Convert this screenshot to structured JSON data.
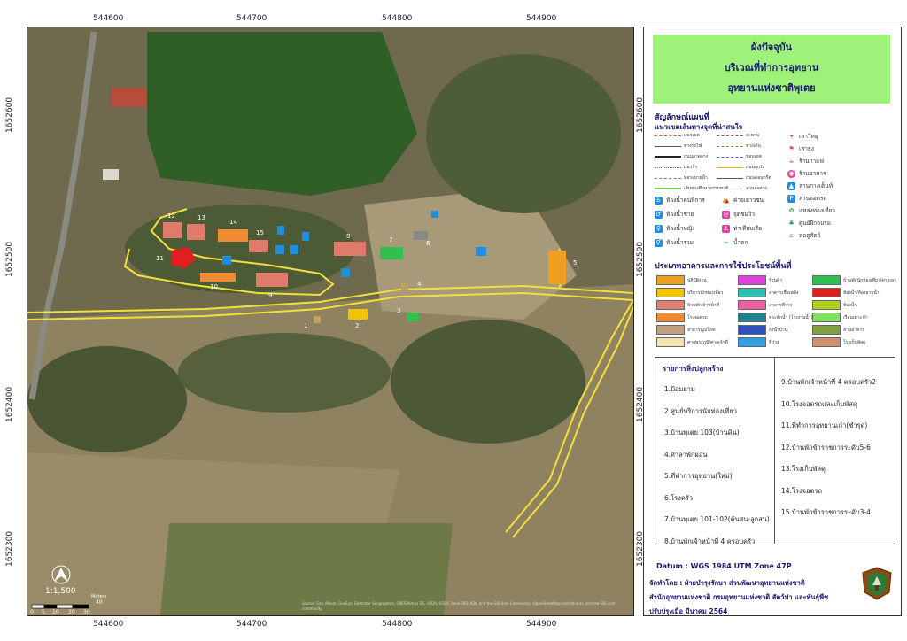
{
  "coordinates": {
    "x_top": [
      "544600",
      "544700",
      "544800",
      "544900"
    ],
    "x_bottom": [
      "544600",
      "544700",
      "544800",
      "544900"
    ],
    "y_left": [
      "1652600",
      "1652500",
      "1652400",
      "1652300"
    ],
    "y_right": [
      "1652600",
      "1652500",
      "1652400",
      "1652300"
    ]
  },
  "title": {
    "line1": "ผังปัจจุบัน",
    "line2": "บริเวณที่ทำการอุทยาน",
    "line3": "อุทยานแห่งชาติพุเตย"
  },
  "legend": {
    "heading": "สัญลักษณ์แผนที่",
    "sub": "แนวเขตเส้นทางจุดที่น่าสนใจ",
    "lines": [
      {
        "label": "แนวเขต",
        "color": "#e04a4a"
      },
      {
        "label": "ทางรถไฟ",
        "color": "#555555"
      },
      {
        "label": "ถนนลาดยาง",
        "color": "#222222"
      },
      {
        "label": "แนวรั้ว",
        "color": "#777777"
      },
      {
        "label": "สะพาน",
        "color": "#a05050"
      },
      {
        "label": "ทางเดิน",
        "color": "#b08040"
      },
      {
        "label": "ขอบเขต",
        "color": "#4060c0"
      },
      {
        "label": "ถนนลูกรัง",
        "color": "#e0c000"
      },
      {
        "label": "ท่อระบายน้ำ",
        "color": "#b060b0"
      },
      {
        "label": "ถนนคอนกรีต",
        "color": "#555555"
      },
      {
        "label": "เส้นทางศึกษาธรรมชาติ",
        "color": "#7ad04a"
      },
      {
        "label": "ลานจอดรถ",
        "color": "#999999"
      }
    ],
    "symbols": [
      {
        "label": "เสาวิทยุ",
        "color": "#ffffff",
        "glyph": "✦"
      },
      {
        "label": "เสาธง",
        "color": "#ffffff",
        "glyph": "⚑"
      },
      {
        "label": "ร้านกาแฟ",
        "color": "#ffffff",
        "glyph": "☕"
      },
      {
        "label": "ร้านอาหาร",
        "color": "#e040a0",
        "glyph": "◉"
      },
      {
        "label": "ลานกางเต็นท์",
        "color": "#1e8fe0",
        "glyph": "▲"
      },
      {
        "label": "ลานจอดรถ",
        "color": "#1e8fe0",
        "glyph": "P"
      },
      {
        "label": "แหล่งท่องเที่ยว",
        "color": "#ffffff",
        "glyph": "✿"
      },
      {
        "label": "ศูนย์ฝึกอบรม",
        "color": "#ffffff",
        "glyph": "♣"
      },
      {
        "label": "หอดูสัตว์",
        "color": "#ffffff",
        "glyph": "⌂"
      },
      {
        "label": "ห้องน้ำคนพิการ",
        "color": "#1e8fe0",
        "glyph": "♿"
      },
      {
        "label": "ค่ายเยาวชน",
        "color": "#ffffff",
        "glyph": "⛺"
      },
      {
        "label": "ห้องน้ำชาย",
        "color": "#1e8fe0",
        "glyph": "♂"
      },
      {
        "label": "จุดชมวิว",
        "color": "#e040a0",
        "glyph": "◎"
      },
      {
        "label": "ห้องน้ำหญิง",
        "color": "#1e8fe0",
        "glyph": "♀"
      },
      {
        "label": "ท่าเทียบเรือ",
        "color": "#e040a0",
        "glyph": "⚓"
      },
      {
        "label": "ห้องน้ำรวม",
        "color": "#1e8fe0",
        "glyph": "⚥"
      },
      {
        "label": "น้ำตก",
        "color": "#ffffff",
        "glyph": "≈"
      }
    ],
    "landuse_heading": "ประเภทอาคารและการใช้ประโยชน์พื้นที่",
    "landuse": [
      {
        "label": "ปฏิบัติงาน",
        "color": "#f0a020"
      },
      {
        "label": "บริการนักท่องเที่ยว",
        "color": "#f5c400"
      },
      {
        "label": "บ้านพักเจ้าหน้าที่",
        "color": "#e08070"
      },
      {
        "label": "โรงจอดรถ",
        "color": "#f08a30"
      },
      {
        "label": "สาธารณูปโภค",
        "color": "#c0a080"
      },
      {
        "label": "ศาลพระภูมิ/ศาลเจ้าที่",
        "color": "#f5e0b0"
      },
      {
        "label": "ร้านค้า",
        "color": "#e040e0"
      },
      {
        "label": "อาคารเชื้อเพลิง",
        "color": "#30c0b0"
      },
      {
        "label": "อาคารที่ว่าง",
        "color": "#f060a0"
      },
      {
        "label": "พระพักน้ำ (โรงงานน้ำ)",
        "color": "#208090"
      },
      {
        "label": "ถังน้ำบ้าน",
        "color": "#3050c0"
      },
      {
        "label": "ที่ว่าง",
        "color": "#30a0e0"
      },
      {
        "label": "บ้านพักนักท่องเที่ยว/ค่ายเยาวชน",
        "color": "#30c050"
      },
      {
        "label": "ห้องน้ำ/ห้องอาบน้ำ",
        "color": "#e02020"
      },
      {
        "label": "ห้องน้ำ",
        "color": "#b0d020"
      },
      {
        "label": "เรือนเพาะชำ",
        "color": "#80e060"
      },
      {
        "label": "ลานอาคาร",
        "color": "#80a040"
      },
      {
        "label": "โรงเก็บพัสดุ",
        "color": "#d0906a"
      }
    ]
  },
  "buildings_list": {
    "heading": "รายการสิ่งปลูกสร้าง",
    "left": [
      "1.ป้อมยาม",
      "2.ศูนย์บริการนักท่องเที่ยว",
      "3.บ้านพุเตย 103(บ้านดิน)",
      "4.ศาลาพักผ่อน",
      "5.ที่ทำการอุทยาน(ใหม่)",
      "6.โรงครัว",
      "7.บ้านพุเตย 101-102(ต้นสน-ลูกสน)",
      "8.บ้านพักเจ้าหน้าที่ 4 ครอบครัว"
    ],
    "right": [
      "9.บ้านพักเจ้าหน้าที่ 4 ครอบครัว2",
      "10.โรงจอดรถและเก็บพัสดุ",
      "11.ที่ทำการอุทยานเก่า(ชำรุด)",
      "12.บ้านพักข้าราชการระดับ5-6",
      "13.โรงเก็บพัสดุ",
      "14.โรงจอดรถ",
      "15.บ้านพักข้าราชการระดับ3-4"
    ]
  },
  "datum": "Datum  : WGS 1984 UTM Zone 47P",
  "credits": {
    "line1": "จัดทำโดย  : ฝ่ายบำรุงรักษา ส่วนพัฒนาอุทยานแห่งชาติ",
    "line2": "สำนักอุทยานแห่งชาติ  กรมอุทยานแห่งชาติ สัตว์ป่า และพันธุ์พืช",
    "line3": "ปรับปรุงเมื่อ มีนาคม 2564"
  },
  "scale": {
    "ratio": "1:1,500",
    "ticks": [
      "0",
      "5",
      "10",
      "20",
      "30",
      "40"
    ],
    "unit": "Meters"
  },
  "map_labels": [
    "1",
    "2",
    "3",
    "4",
    "5",
    "6",
    "7",
    "8",
    "9",
    "10",
    "11",
    "12",
    "13",
    "14",
    "15"
  ],
  "attribution": "Source: Esri, Maxar, GeoEye, Earthstar Geographics, CNES/Airbus DS, USDA, USGS, AeroGRID, IGN, and the GIS User Community; OpenStreetMap contributors, and the GIS user community"
}
